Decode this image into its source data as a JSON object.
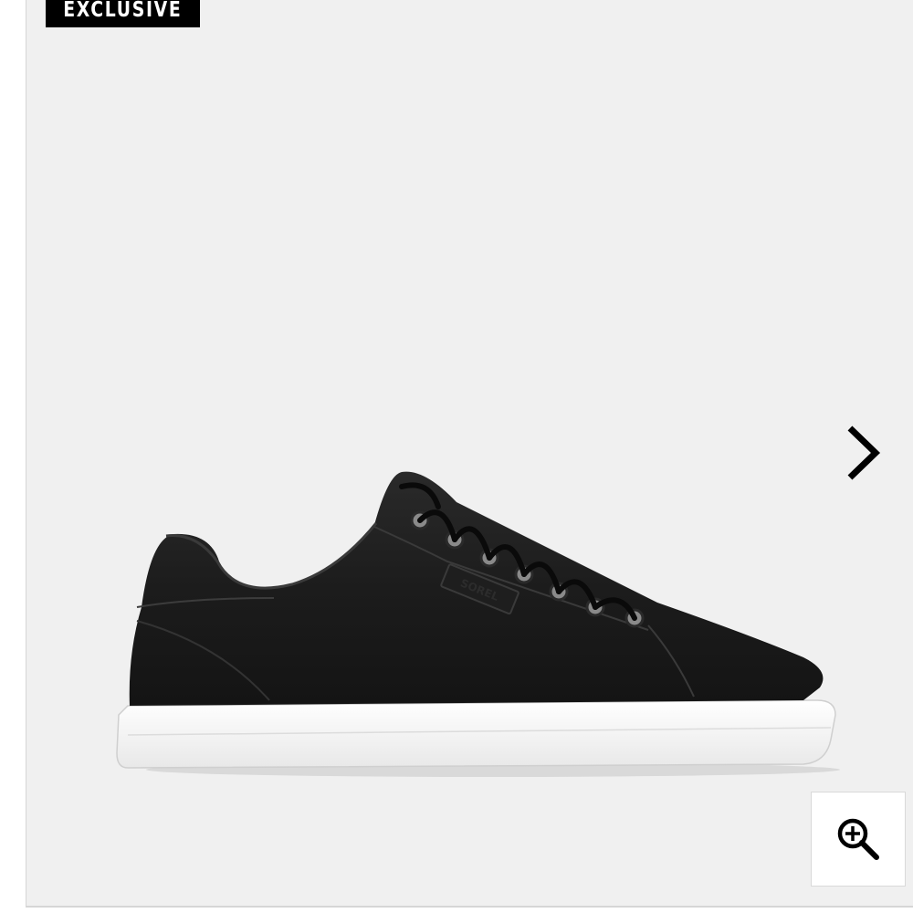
{
  "product_image": {
    "badge_label": "EXCLUSIVE",
    "shoe_brand_mark": "SOREL",
    "next_icon": "chevron-right-icon",
    "zoom_icon": "zoom-in-icon",
    "colors": {
      "viewer_background": "#f0f0f0",
      "badge_background": "#000000",
      "badge_text": "#ffffff",
      "shoe_upper": "#1a1a1a",
      "sole": "#ffffff"
    }
  }
}
